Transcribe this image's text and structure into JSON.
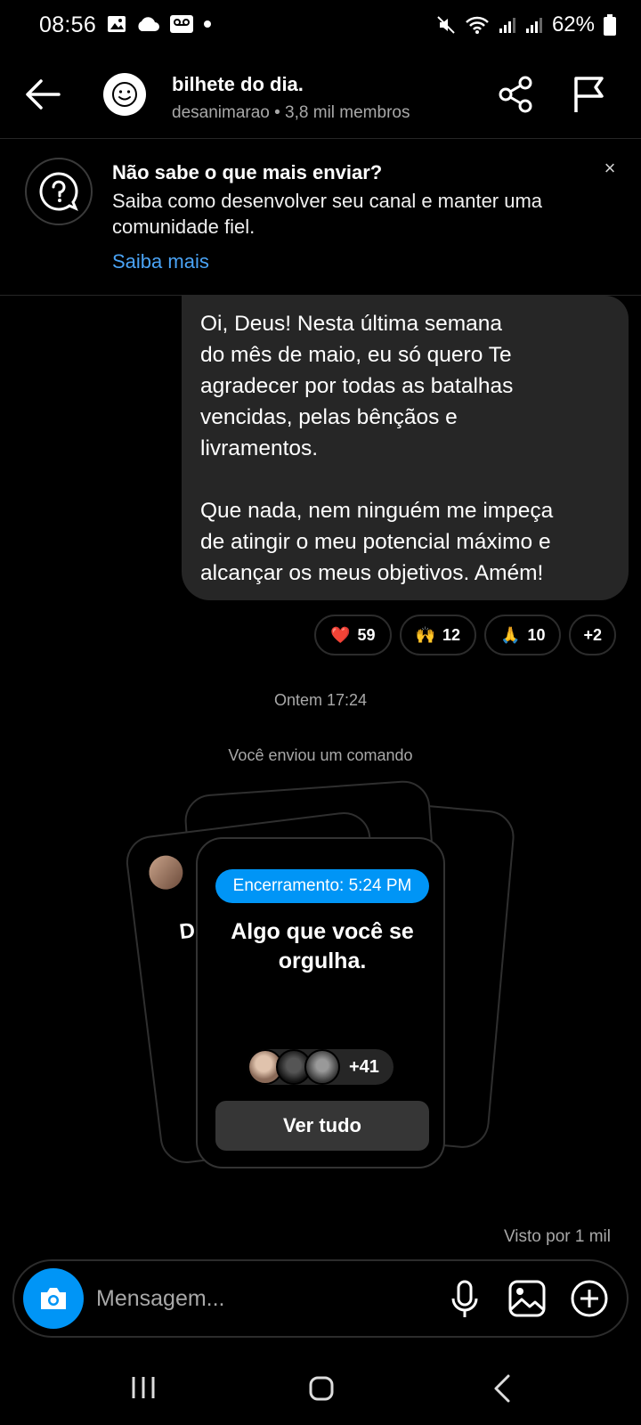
{
  "status_bar": {
    "time": "08:56",
    "battery": "62%",
    "icons": [
      "image-icon",
      "cloud-icon",
      "voicemail-icon",
      "dot-icon",
      "mute-icon",
      "wifi-icon",
      "signal-icon",
      "signal-icon",
      "battery-icon"
    ]
  },
  "header": {
    "title": "bilhete do dia.",
    "subtitle": "desanimarao • 3,8 mil membros"
  },
  "banner": {
    "title": "Não sabe o que mais enviar?",
    "text": "Saiba como desenvolver seu canal e manter uma comunidade fiel.",
    "link": "Saiba mais",
    "close": "×"
  },
  "message": {
    "text": "Oi, Deus! Nesta última semana\ndo mês de maio, eu só quero Te\nagradecer por todas as batalhas\nvencidas, pelas bênçãos e\nlivramentos.\n\nQue nada, nem ninguém me impeça\nde atingir o meu potencial máximo e\nalcançar os meus objetivos. Amém!",
    "reactions": [
      {
        "emoji": "❤️",
        "count": "59"
      },
      {
        "emoji": "🙌",
        "count": "12"
      },
      {
        "emoji": "🙏",
        "count": "10"
      },
      {
        "emoji": "",
        "count": "+2"
      }
    ]
  },
  "timestamp": "Ontem 17:24",
  "system_message": "Você enviou um comando",
  "prompt_card": {
    "back_letter": "D",
    "end_label": "Encerramento: 5:24 PM",
    "prompt": "Algo que você se orgulha.",
    "participants_more": "+41",
    "view_all": "Ver tudo"
  },
  "seen": "Visto por 1 mil",
  "composer": {
    "placeholder": "Mensagem..."
  },
  "colors": {
    "accent": "#0095f6",
    "link": "#4aa3f5",
    "bubble": "#262626",
    "background": "#000000"
  }
}
